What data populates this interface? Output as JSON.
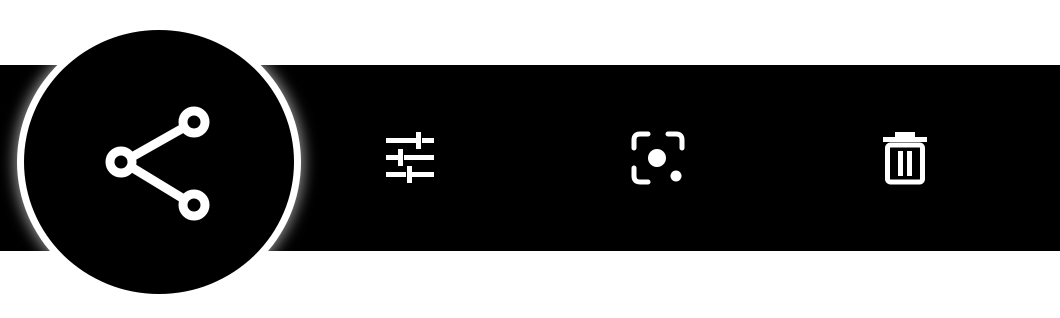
{
  "toolbar": {
    "background_color": "#000000",
    "icon_color": "#ffffff",
    "buttons": [
      {
        "id": "share",
        "icon": "share-icon",
        "emphasized": true
      },
      {
        "id": "adjust",
        "icon": "tune-sliders-icon",
        "emphasized": false
      },
      {
        "id": "lens",
        "icon": "lens-icon",
        "emphasized": false
      },
      {
        "id": "delete",
        "icon": "trash-icon",
        "emphasized": false
      }
    ]
  },
  "highlight": {
    "ring_color": "#ffffff",
    "target": "share"
  }
}
